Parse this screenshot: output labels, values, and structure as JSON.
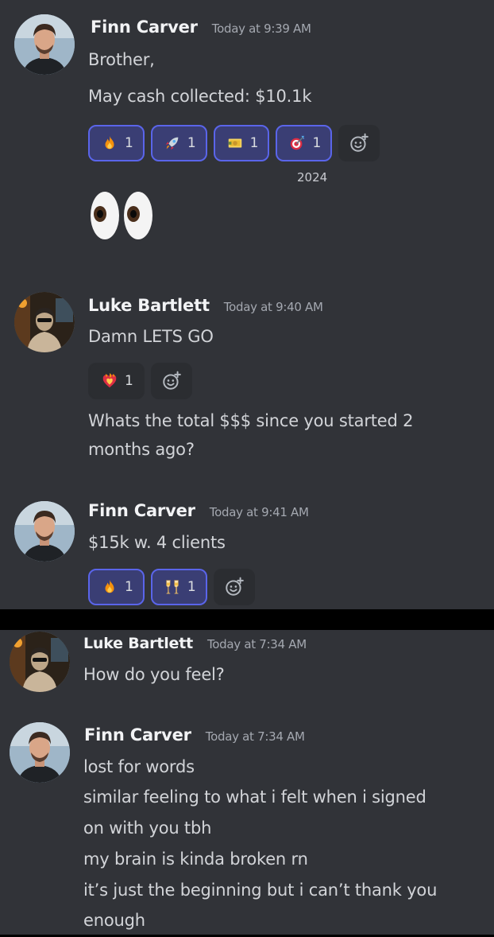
{
  "top_panel": {
    "messages": [
      {
        "author": "Finn Carver",
        "timestamp": "Today at 9:39 AM",
        "lines": [
          "Brother,",
          "May cash collected: $10.1k"
        ],
        "reactions": [
          {
            "emoji": "fire-emoji",
            "count": "1"
          },
          {
            "emoji": "rocket-emoji",
            "count": "1"
          },
          {
            "emoji": "money-emoji",
            "count": "1"
          },
          {
            "emoji": "dart-emoji",
            "count": "1"
          }
        ],
        "reaction_caption": "2024",
        "big_emoji": "eyes-emoji"
      },
      {
        "author": "Luke Bartlett",
        "timestamp": "Today at 9:40 AM",
        "lines": [
          "Damn LETS GO"
        ],
        "reactions": [
          {
            "emoji": "heart-on-fire-emoji",
            "count": "1"
          }
        ],
        "followup_lines": [
          "Whats the total $$$ since you started 2",
          "months ago?"
        ]
      },
      {
        "author": "Finn Carver",
        "timestamp": "Today at 9:41 AM",
        "lines": [
          "$15k w. 4 clients"
        ],
        "reactions": [
          {
            "emoji": "fire-emoji",
            "count": "1"
          },
          {
            "emoji": "champagne-glasses-emoji",
            "count": "1"
          }
        ]
      }
    ]
  },
  "bottom_panel": {
    "messages": [
      {
        "author": "Luke Bartlett",
        "timestamp": "Today at 7:34 AM",
        "lines": [
          "How do you feel?"
        ]
      },
      {
        "author": "Finn Carver",
        "timestamp": "Today at 7:34 AM",
        "lines": [
          "lost for words",
          "similar feeling to what i felt when i signed",
          "on with you tbh",
          "my brain is kinda broken rn",
          "it’s just the beginning but i can’t thank you",
          "enough"
        ]
      }
    ]
  },
  "colors": {
    "background": "#313338",
    "reaction_active_bg": "#3a3e74",
    "reaction_active_border": "#5a65ea",
    "username": "#f2f3f5",
    "message_text": "#d2d4d8",
    "timestamp": "#a4a8b0"
  }
}
